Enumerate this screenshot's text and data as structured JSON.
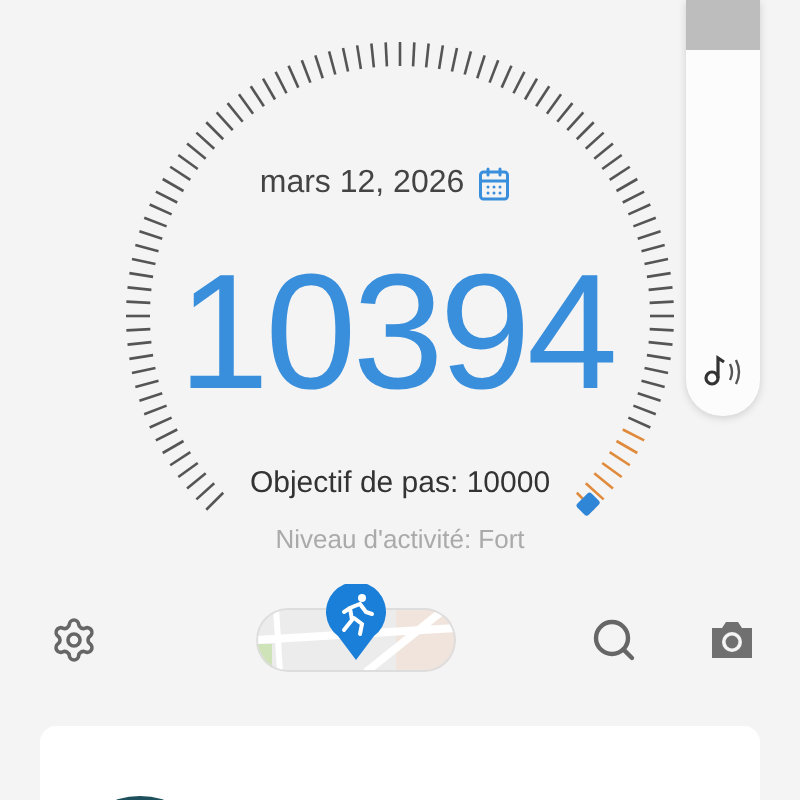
{
  "dial": {
    "date": "mars 12, 2026",
    "steps": "10394",
    "goal": "Objectif de pas: 10000",
    "activity": "Niveau d'activité: Fort"
  },
  "volume": {
    "level": 0.15
  },
  "toolbar": {
    "items": [
      {
        "kind": "settings"
      },
      {
        "kind": "map"
      },
      {
        "kind": "search"
      },
      {
        "kind": "camera"
      }
    ]
  }
}
